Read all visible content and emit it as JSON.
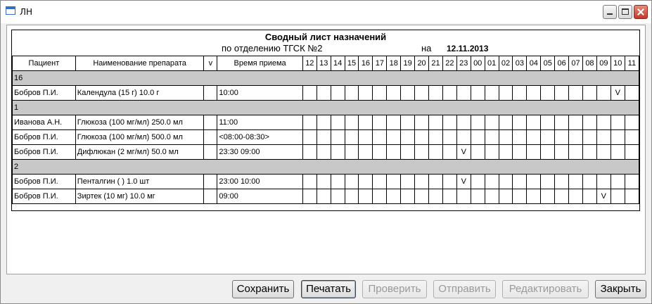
{
  "window": {
    "title": "ЛН"
  },
  "report": {
    "title": "Сводный лист назначений",
    "department_line": "по отделению ТГСК №2",
    "date_prefix": "на",
    "date": "12.11.2013"
  },
  "columns": {
    "patient": "Пациент",
    "drug": "Наименование препарата",
    "v": "v",
    "time": "Время приема",
    "hours": [
      "12",
      "13",
      "14",
      "15",
      "16",
      "17",
      "18",
      "19",
      "20",
      "21",
      "22",
      "23",
      "00",
      "01",
      "02",
      "03",
      "04",
      "05",
      "06",
      "07",
      "08",
      "09",
      "10",
      "11"
    ]
  },
  "rows": [
    {
      "type": "group",
      "label": "16"
    },
    {
      "type": "row",
      "patient": "Бобров П.И.",
      "drug": "Календула (15 г) 10.0 г",
      "v": "",
      "time": "10:00",
      "marks": {
        "10": "V"
      }
    },
    {
      "type": "group",
      "label": "1"
    },
    {
      "type": "row",
      "patient": "Иванова А.Н.",
      "drug": "Глюкоза (100 мг/мл) 250.0 мл",
      "v": "",
      "time": "11:00",
      "marks": {}
    },
    {
      "type": "row",
      "patient": "Бобров П.И.",
      "drug": "Глюкоза (100 мг/мл) 500.0 мл",
      "v": "",
      "time": "<08:00-08:30>",
      "marks": {}
    },
    {
      "type": "row",
      "patient": "Бобров П.И.",
      "drug": "Дифлюкан (2 мг/мл) 50.0 мл",
      "v": "",
      "time": "23:30 09:00",
      "marks": {
        "23": "V"
      }
    },
    {
      "type": "group",
      "label": "2"
    },
    {
      "type": "row",
      "patient": "Бобров П.И.",
      "drug": "Пенталгин ( ) 1.0 шт",
      "v": "",
      "time": "23:00 10:00",
      "marks": {
        "23": "V"
      }
    },
    {
      "type": "row",
      "patient": "Бобров П.И.",
      "drug": "Зиртек (10 мг) 10.0 мг",
      "v": "",
      "time": "09:00",
      "marks": {
        "09": "V"
      }
    }
  ],
  "buttons": {
    "save": "Сохранить",
    "print": "Печатать",
    "check": "Проверить",
    "send": "Отправить",
    "edit": "Редактировать",
    "close": "Закрыть"
  }
}
